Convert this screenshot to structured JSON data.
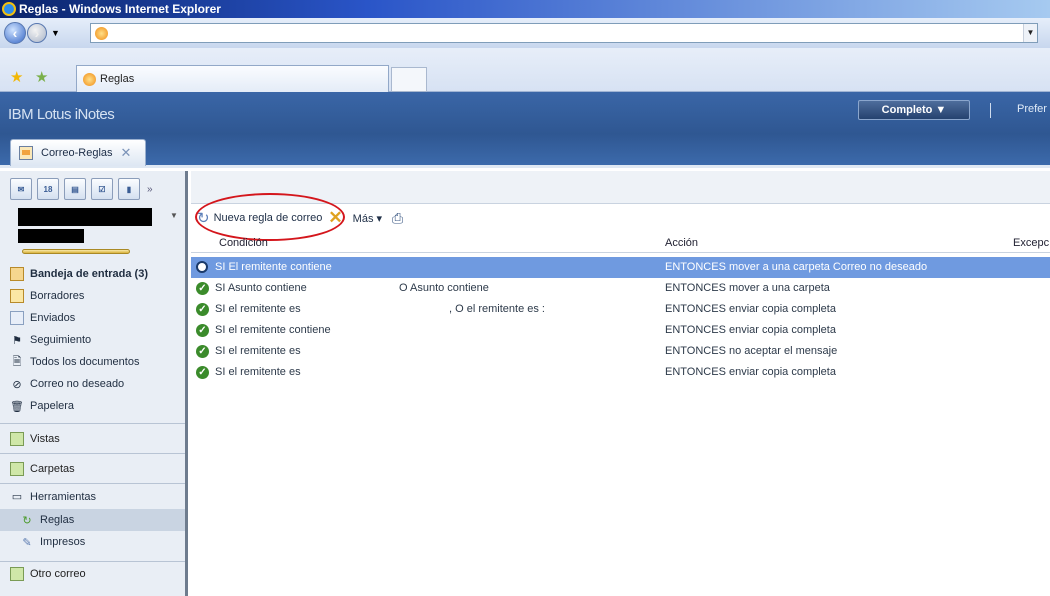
{
  "window": {
    "title": "Reglas - Windows Internet Explorer"
  },
  "browser": {
    "tab_label": "Reglas"
  },
  "header": {
    "brand": "IBM Lotus iNotes",
    "mode_button": "Completo ▼",
    "prefs_link": "Prefer"
  },
  "app_tab": {
    "label": "Correo-Reglas",
    "close": "✕"
  },
  "nav": {
    "items": [
      {
        "label": "Bandeja de entrada (3)"
      },
      {
        "label": "Borradores"
      },
      {
        "label": "Enviados"
      },
      {
        "label": "Seguimiento"
      },
      {
        "label": "Todos los documentos"
      },
      {
        "label": "Correo no deseado"
      },
      {
        "label": "Papelera"
      }
    ],
    "sections": [
      {
        "label": "Vistas"
      },
      {
        "label": "Carpetas"
      }
    ],
    "tools": {
      "label": "Herramientas",
      "children": [
        {
          "label": "Reglas"
        },
        {
          "label": "Impresos"
        }
      ]
    },
    "other_mail": "Otro correo"
  },
  "toolbar": {
    "new_rule": "Nueva regla de correo",
    "more": "Más ▾"
  },
  "table": {
    "headers": {
      "condition": "Condición",
      "action": "Acción",
      "exception": "Excepc"
    },
    "rows": [
      {
        "condition": "SI El remitente contiene",
        "condition2": "",
        "action": "ENTONCES mover a una carpeta Correo no deseado",
        "status": "selected"
      },
      {
        "condition": "SI Asunto contiene",
        "condition2": "O Asunto contiene",
        "action": "ENTONCES mover a una carpeta",
        "status": "enabled"
      },
      {
        "condition": "SI el remitente es",
        "condition2": ", O el remitente es :",
        "action": "ENTONCES enviar copia completa",
        "status": "enabled"
      },
      {
        "condition": "SI el remitente contiene",
        "condition2": "",
        "action": "ENTONCES enviar copia completa",
        "status": "enabled"
      },
      {
        "condition": "SI el remitente es",
        "condition2": "",
        "action": "ENTONCES no aceptar el mensaje",
        "status": "enabled"
      },
      {
        "condition": "SI el remitente es",
        "condition2": "",
        "action": "ENTONCES enviar copia completa",
        "status": "enabled"
      }
    ]
  }
}
